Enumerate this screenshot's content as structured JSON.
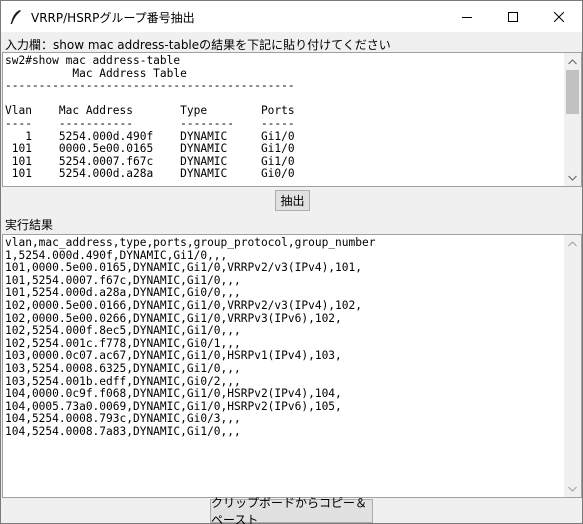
{
  "window": {
    "title": "VRRP/HSRPグループ番号抽出"
  },
  "input": {
    "label": "入力欄：show mac address-tableの結果を下記に貼り付けてください",
    "text": "sw2#show mac address-table\n          Mac Address Table\n-------------------------------------------\n\nVlan    Mac Address       Type        Ports\n----    -----------       --------    -----\n   1    5254.000d.490f    DYNAMIC     Gi1/0\n 101    0000.5e00.0165    DYNAMIC     Gi1/0\n 101    5254.0007.f67c    DYNAMIC     Gi1/0\n 101    5254.000d.a28a    DYNAMIC     Gi0/0"
  },
  "extract_button": {
    "label": "抽出"
  },
  "result": {
    "label": "実行結果",
    "text": "vlan,mac_address,type,ports,group_protocol,group_number\n1,5254.000d.490f,DYNAMIC,Gi1/0,,,\n101,0000.5e00.0165,DYNAMIC,Gi1/0,VRRPv2/v3(IPv4),101,\n101,5254.0007.f67c,DYNAMIC,Gi1/0,,,\n101,5254.000d.a28a,DYNAMIC,Gi0/0,,,\n102,0000.5e00.0166,DYNAMIC,Gi1/0,VRRPv2/v3(IPv4),102,\n102,0000.5e00.0266,DYNAMIC,Gi1/0,VRRPv3(IPv6),102,\n102,5254.000f.8ec5,DYNAMIC,Gi1/0,,,\n102,5254.001c.f778,DYNAMIC,Gi0/1,,,\n103,0000.0c07.ac67,DYNAMIC,Gi1/0,HSRPv1(IPv4),103,\n103,5254.0008.6325,DYNAMIC,Gi1/0,,,\n103,5254.001b.edff,DYNAMIC,Gi0/2,,,\n104,0000.0c9f.f068,DYNAMIC,Gi1/0,HSRPv2(IPv4),104,\n104,0005.73a0.0069,DYNAMIC,Gi1/0,HSRPv2(IPv6),105,\n104,5254.0008.793c,DYNAMIC,Gi0/3,,,\n104,5254.0008.7a83,DYNAMIC,Gi1/0,,,"
  },
  "copy_button": {
    "label": "クリップボードからコピー＆ペースト"
  },
  "icons": {
    "app": "feather-icon",
    "minimize": "minimize-icon",
    "maximize": "maximize-icon",
    "close": "close-icon"
  }
}
